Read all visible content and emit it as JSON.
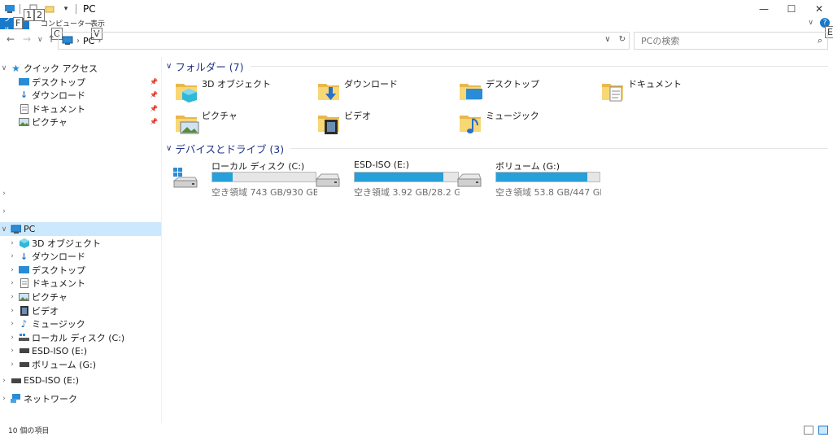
{
  "window": {
    "title": "PC",
    "minimize": "—",
    "maximize": "☐",
    "close": "✕"
  },
  "ribbon": {
    "file_tab": "ファイル",
    "tabs": [
      "コンピューター",
      "表示"
    ],
    "keytips": [
      "F",
      "1",
      "2",
      "C",
      "V",
      "E"
    ],
    "expand_icon": "chevron-down-icon",
    "help": "?"
  },
  "address": {
    "back": "←",
    "forward": "→",
    "recent": "∨",
    "up": "↑",
    "crumbs": [
      "PC"
    ],
    "dropdown": "∨",
    "refresh": "↻",
    "search_placeholder": "PCの検索"
  },
  "navpane": {
    "quick_access": {
      "label": "クイック アクセス",
      "items": [
        {
          "label": "デスクトップ",
          "icon": "desktop-icon"
        },
        {
          "label": "ダウンロード",
          "icon": "download-icon"
        },
        {
          "label": "ドキュメント",
          "icon": "document-icon"
        },
        {
          "label": "ピクチャ",
          "icon": "picture-icon"
        }
      ]
    },
    "pc": {
      "label": "PC",
      "items": [
        {
          "label": "3D オブジェクト",
          "icon": "3d-objects-icon"
        },
        {
          "label": "ダウンロード",
          "icon": "download-icon"
        },
        {
          "label": "デスクトップ",
          "icon": "desktop-icon"
        },
        {
          "label": "ドキュメント",
          "icon": "document-icon"
        },
        {
          "label": "ピクチャ",
          "icon": "picture-icon"
        },
        {
          "label": "ビデオ",
          "icon": "video-icon"
        },
        {
          "label": "ミュージック",
          "icon": "music-icon"
        },
        {
          "label": "ローカル ディスク (C:)",
          "icon": "local-disk-icon"
        },
        {
          "label": "ESD-ISO (E:)",
          "icon": "drive-icon"
        },
        {
          "label": "ボリューム (G:)",
          "icon": "drive-icon"
        }
      ]
    },
    "esd_iso": "ESD-ISO (E:)",
    "network": "ネットワーク"
  },
  "content": {
    "folders_header": "フォルダー (7)",
    "folders": [
      {
        "name": "3D オブジェクト",
        "icon": "3d-objects-icon"
      },
      {
        "name": "ダウンロード",
        "icon": "download-icon"
      },
      {
        "name": "デスクトップ",
        "icon": "desktop-icon"
      },
      {
        "name": "ドキュメント",
        "icon": "document-icon"
      },
      {
        "name": "ピクチャ",
        "icon": "picture-icon"
      },
      {
        "name": "ビデオ",
        "icon": "video-icon"
      },
      {
        "name": "ミュージック",
        "icon": "music-icon"
      }
    ],
    "drives_header": "デバイスとドライブ (3)",
    "drives": [
      {
        "name": "ローカル ディスク (C:)",
        "free": "空き領域 743 GB/930 GB",
        "used_fraction": 0.2
      },
      {
        "name": "ESD-ISO (E:)",
        "free": "空き領域 3.92 GB/28.2 GB",
        "used_fraction": 0.86
      },
      {
        "name": "ボリューム (G:)",
        "free": "空き領域 53.8 GB/447 GB",
        "used_fraction": 0.88
      }
    ]
  },
  "status": {
    "count": "10 個の項目"
  },
  "colors": {
    "accent": "#1979ca",
    "group_header": "#1e3287",
    "drive_fill": "#26a0da",
    "selected": "#cce8ff",
    "folder_yellow": "#f8d775"
  }
}
